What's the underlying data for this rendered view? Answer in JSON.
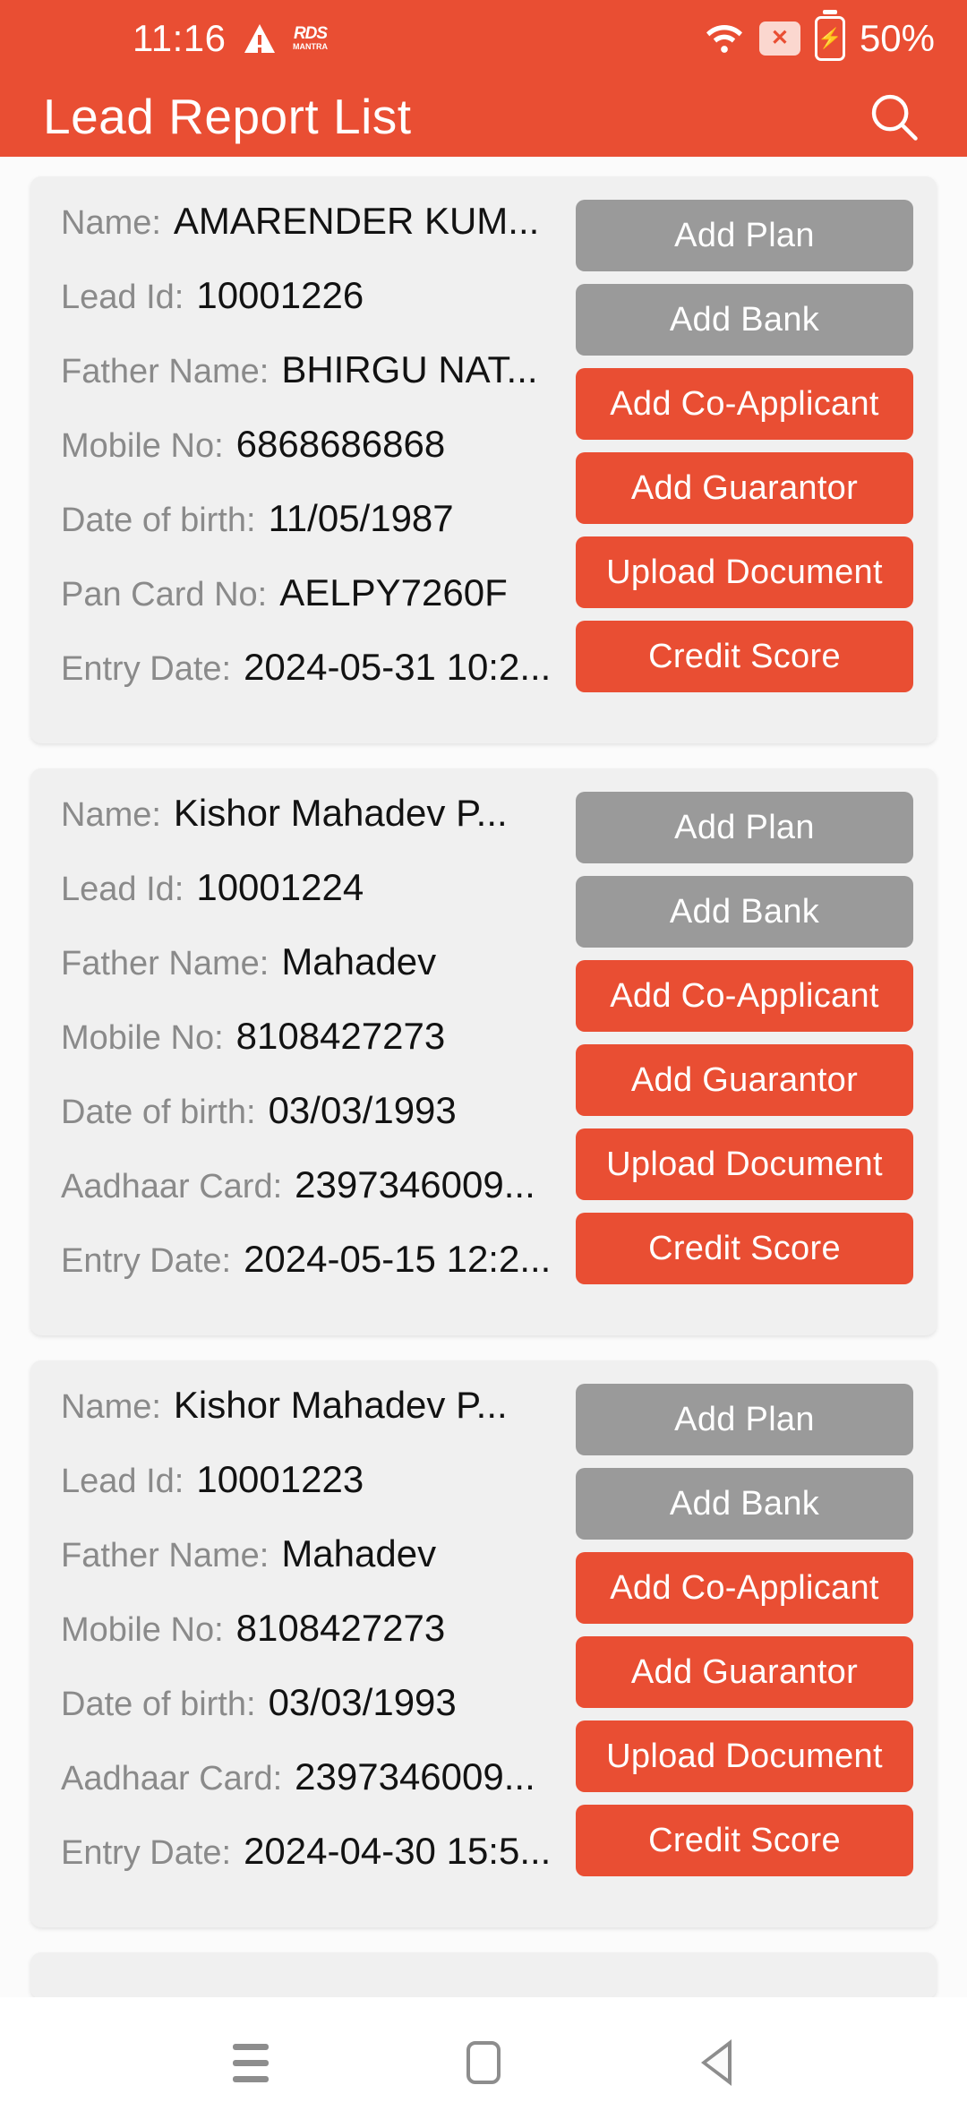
{
  "status_bar": {
    "clock": "11:16",
    "battery_percent": "50%",
    "icons": [
      "warning-triangle-icon",
      "rd-mantra-logo-icon",
      "wifi-icon",
      "sim-error-icon",
      "battery-charging-icon"
    ],
    "rd_logo_top": "RDS",
    "rd_logo_bottom": "MANTRA"
  },
  "app_bar": {
    "title": "Lead Report List",
    "search_icon": "search-icon"
  },
  "theme": {
    "accent": "#e94e33",
    "grey_button": "#9a9a9a",
    "card_bg": "#f0f0f0",
    "page_bg": "#fbfbfb",
    "label_color": "#8a8a8a",
    "value_color": "#121212"
  },
  "action_labels": {
    "add_plan": "Add Plan",
    "add_bank": "Add Bank",
    "add_co_applicant": "Add Co-Applicant",
    "add_guarantor": "Add Guarantor",
    "upload_document": "Upload Document",
    "credit_score": "Credit Score"
  },
  "cards": [
    {
      "fields": [
        {
          "label": "Name:",
          "value": "AMARENDER KUM..."
        },
        {
          "label": "Lead Id:",
          "value": "10001226"
        },
        {
          "label": "Father Name:",
          "value": "BHIRGU NAT..."
        },
        {
          "label": "Mobile No:",
          "value": "6868686868"
        },
        {
          "label": "Date of birth:",
          "value": "11/05/1987"
        },
        {
          "label": "Pan Card No:",
          "value": "AELPY7260F"
        },
        {
          "label": "Entry Date:",
          "value": "2024-05-31 10:2..."
        }
      ],
      "actions": [
        {
          "label": "Add Plan",
          "style": "grey"
        },
        {
          "label": "Add Bank",
          "style": "grey"
        },
        {
          "label": "Add Co-Applicant",
          "style": "red"
        },
        {
          "label": "Add Guarantor",
          "style": "red"
        },
        {
          "label": "Upload Document",
          "style": "red"
        },
        {
          "label": "Credit Score",
          "style": "red"
        }
      ]
    },
    {
      "fields": [
        {
          "label": "Name:",
          "value": "Kishor Mahadev P..."
        },
        {
          "label": "Lead Id:",
          "value": "10001224"
        },
        {
          "label": "Father Name:",
          "value": "Mahadev"
        },
        {
          "label": "Mobile No:",
          "value": "8108427273"
        },
        {
          "label": "Date of birth:",
          "value": "03/03/1993"
        },
        {
          "label": "Aadhaar Card:",
          "value": "2397346009..."
        },
        {
          "label": "Entry Date:",
          "value": "2024-05-15 12:2..."
        }
      ],
      "actions": [
        {
          "label": "Add Plan",
          "style": "grey"
        },
        {
          "label": "Add Bank",
          "style": "grey"
        },
        {
          "label": "Add Co-Applicant",
          "style": "red"
        },
        {
          "label": "Add Guarantor",
          "style": "red"
        },
        {
          "label": "Upload Document",
          "style": "red"
        },
        {
          "label": "Credit Score",
          "style": "red"
        }
      ]
    },
    {
      "fields": [
        {
          "label": "Name:",
          "value": "Kishor Mahadev P..."
        },
        {
          "label": "Lead Id:",
          "value": "10001223"
        },
        {
          "label": "Father Name:",
          "value": "Mahadev"
        },
        {
          "label": "Mobile No:",
          "value": "8108427273"
        },
        {
          "label": "Date of birth:",
          "value": "03/03/1993"
        },
        {
          "label": "Aadhaar Card:",
          "value": "2397346009..."
        },
        {
          "label": "Entry Date:",
          "value": "2024-04-30 15:5..."
        }
      ],
      "actions": [
        {
          "label": "Add Plan",
          "style": "grey"
        },
        {
          "label": "Add Bank",
          "style": "grey"
        },
        {
          "label": "Add Co-Applicant",
          "style": "red"
        },
        {
          "label": "Add Guarantor",
          "style": "red"
        },
        {
          "label": "Upload Document",
          "style": "red"
        },
        {
          "label": "Credit Score",
          "style": "red"
        }
      ]
    }
  ],
  "nav_bar": {
    "recents_icon": "recents-hamburger-icon",
    "home_icon": "home-square-icon",
    "back_icon": "back-triangle-icon"
  }
}
